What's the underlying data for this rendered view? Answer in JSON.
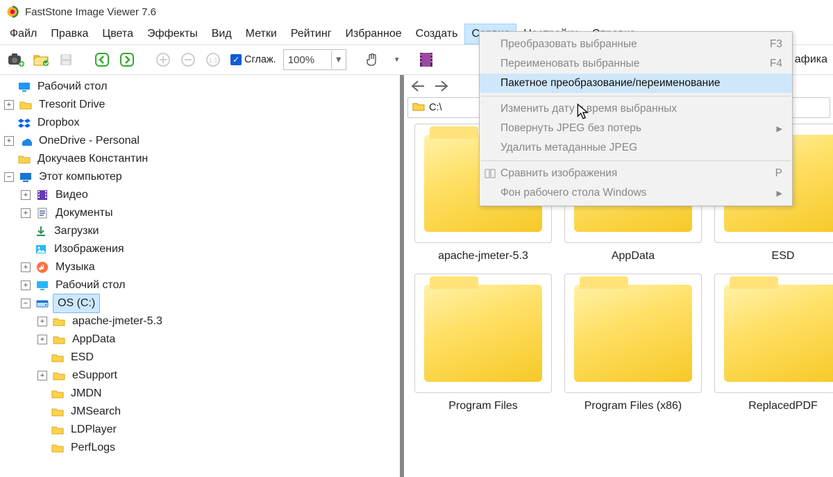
{
  "app": {
    "title": "FastStone Image Viewer 7.6"
  },
  "menu": {
    "items": [
      "Файл",
      "Правка",
      "Цвета",
      "Эффекты",
      "Вид",
      "Метки",
      "Рейтинг",
      "Избранное",
      "Создать",
      "Сервис",
      "Настройки",
      "Справка"
    ],
    "open_index": 9
  },
  "toolbar": {
    "smooth_label": "Сглаж.",
    "zoom_value": "100%",
    "right_cut_label": "афика"
  },
  "dropdown": [
    {
      "label": "Преобразовать выбранные",
      "enabled": false,
      "shortcut": "F3"
    },
    {
      "label": "Переименовать выбранные",
      "enabled": false,
      "shortcut": "F4"
    },
    {
      "label": "Пакетное преобразование/переименование",
      "enabled": true,
      "hover": true
    },
    {
      "sep": true
    },
    {
      "label": "Изменить дату и время выбранных",
      "enabled": false
    },
    {
      "label": "Повернуть JPEG без потерь",
      "enabled": false,
      "submenu": true
    },
    {
      "label": "Удалить метаданные JPEG",
      "enabled": false
    },
    {
      "sep": true
    },
    {
      "label": "Сравнить изображения",
      "enabled": false,
      "shortcut": "P",
      "icon": "compare"
    },
    {
      "label": "Фон рабочего стола Windows",
      "enabled": false,
      "submenu": true
    }
  ],
  "nav": {
    "path_label": "C:\\"
  },
  "thumbnails": [
    {
      "label": "apache-jmeter-5.3"
    },
    {
      "label": "AppData"
    },
    {
      "label": "ESD"
    },
    {
      "label": "Program Files"
    },
    {
      "label": "Program Files (x86)"
    },
    {
      "label": "ReplacedPDF"
    }
  ],
  "tree": [
    {
      "indent": 0,
      "tw": "none",
      "icon": "desktop",
      "label": "Рабочий стол"
    },
    {
      "indent": 0,
      "tw": "plus",
      "icon": "folder",
      "label": "Tresorit Drive"
    },
    {
      "indent": 0,
      "tw": "none",
      "icon": "dropbox",
      "label": "Dropbox"
    },
    {
      "indent": 0,
      "tw": "plus",
      "icon": "onedrive",
      "label": "OneDrive - Personal"
    },
    {
      "indent": 0,
      "tw": "none",
      "icon": "folder",
      "label": "Докучаев Константин"
    },
    {
      "indent": 0,
      "tw": "minus",
      "icon": "pc",
      "label": "Этот компьютер"
    },
    {
      "indent": 1,
      "tw": "plus",
      "icon": "video",
      "label": "Видео"
    },
    {
      "indent": 1,
      "tw": "plus",
      "icon": "docs",
      "label": "Документы"
    },
    {
      "indent": 1,
      "tw": "none",
      "icon": "download",
      "label": "Загрузки"
    },
    {
      "indent": 1,
      "tw": "none",
      "icon": "pictures",
      "label": "Изображения"
    },
    {
      "indent": 1,
      "tw": "plus",
      "icon": "music",
      "label": "Музыка"
    },
    {
      "indent": 1,
      "tw": "plus",
      "icon": "desktop2",
      "label": "Рабочий стол"
    },
    {
      "indent": 1,
      "tw": "minus",
      "icon": "drive",
      "label": "OS (C:)",
      "selected": true
    },
    {
      "indent": 2,
      "tw": "plus",
      "icon": "folder",
      "label": "apache-jmeter-5.3"
    },
    {
      "indent": 2,
      "tw": "plus",
      "icon": "folder",
      "label": "AppData"
    },
    {
      "indent": 2,
      "tw": "none",
      "icon": "folder",
      "label": "ESD"
    },
    {
      "indent": 2,
      "tw": "plus",
      "icon": "folder",
      "label": "eSupport"
    },
    {
      "indent": 2,
      "tw": "none",
      "icon": "folder",
      "label": "JMDN"
    },
    {
      "indent": 2,
      "tw": "none",
      "icon": "folder",
      "label": "JMSearch"
    },
    {
      "indent": 2,
      "tw": "none",
      "icon": "folder",
      "label": "LDPlayer"
    },
    {
      "indent": 2,
      "tw": "none",
      "icon": "folder",
      "label": "PerfLogs"
    }
  ],
  "icons": {
    "desktop": "desktop",
    "folder": "folder",
    "dropbox": "dropbox",
    "onedrive": "onedrive",
    "pc": "pc",
    "video": "video",
    "docs": "docs",
    "download": "download",
    "pictures": "pictures",
    "music": "music",
    "desktop2": "desktop2",
    "drive": "drive"
  }
}
